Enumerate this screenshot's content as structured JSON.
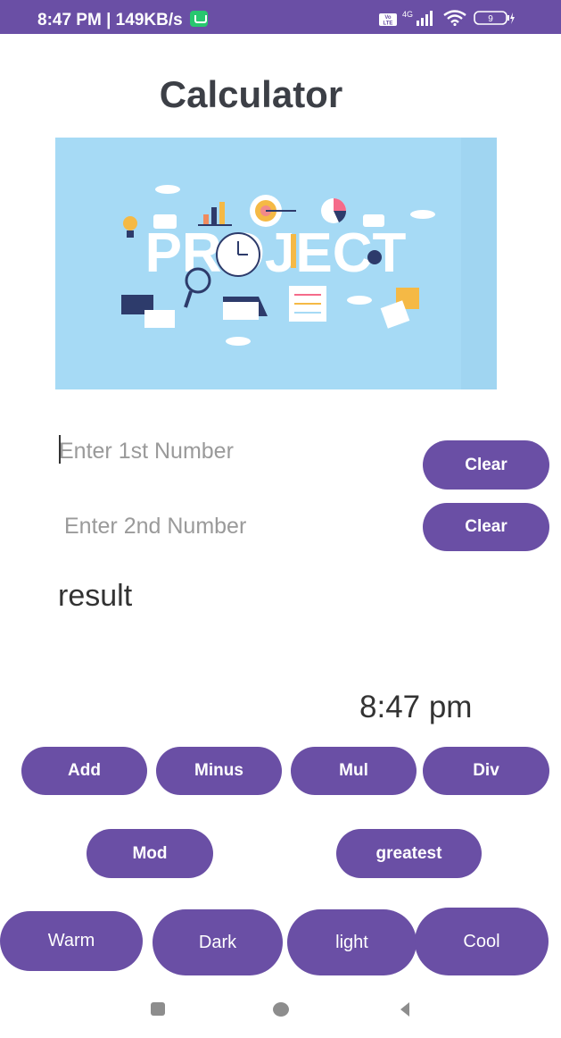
{
  "status_bar": {
    "time_speed": "8:47 PM | 149KB/s",
    "volte": "Vo LTE",
    "network": "4G",
    "battery": "9",
    "bg_color": "#6a4fa5"
  },
  "app": {
    "title": "Calculator",
    "banner_word": "PROJECT",
    "accent_color": "#6a4fa5"
  },
  "inputs": {
    "first_placeholder": "Enter 1st Number",
    "first_value": "",
    "second_placeholder": "Enter 2nd Number",
    "second_value": ""
  },
  "buttons": {
    "clear1": "Clear",
    "clear2": "Clear",
    "add": "Add",
    "minus": "Minus",
    "mul": "Mul",
    "div": "Div",
    "mod": "Mod",
    "greatest": "greatest",
    "warm": "Warm",
    "dark": "Dark",
    "light": "light",
    "cool": "Cool"
  },
  "result_label": "result",
  "clock_text": "8:47 pm",
  "nav": {
    "recent_icon": "square-recent-icon",
    "home_icon": "circle-home-icon",
    "back_icon": "triangle-back-icon"
  }
}
